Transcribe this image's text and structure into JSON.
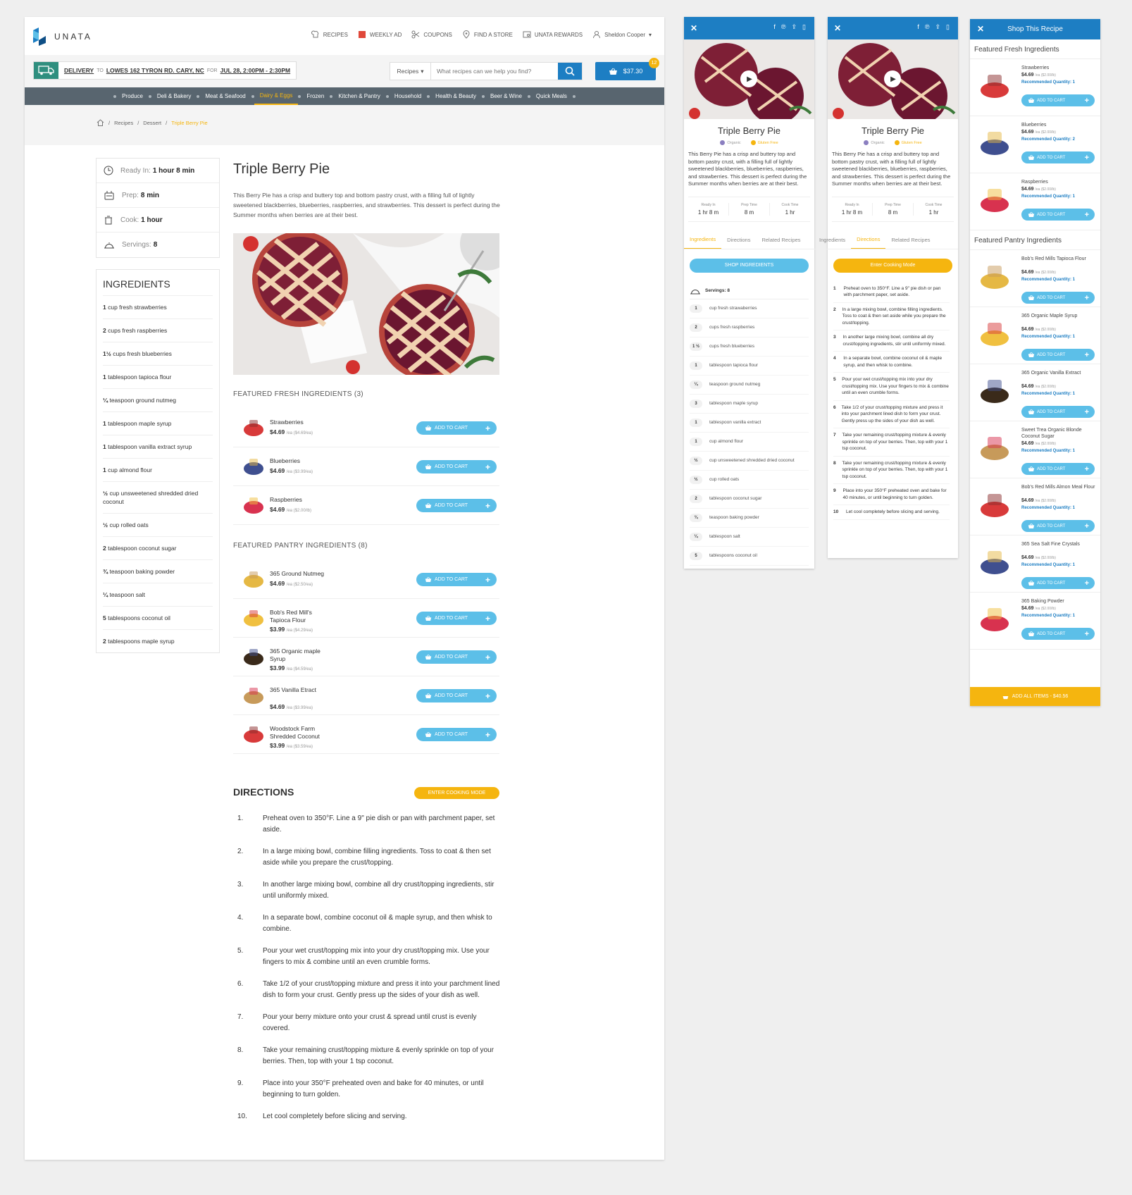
{
  "brand": {
    "name": "UNATA",
    "accent": "#1d7ec3",
    "secondary": "#5cbfe8",
    "highlight": "#f5b50f",
    "nav_bg": "#58656f"
  },
  "top_nav": [
    {
      "label": "Recipes",
      "icon": "chef-hat-icon"
    },
    {
      "label": "Weekly Ad",
      "icon": "flyer-icon"
    },
    {
      "label": "Coupons",
      "icon": "scissors-icon"
    },
    {
      "label": "Find a Store",
      "icon": "map-pin-icon"
    },
    {
      "label": "Unata Rewards",
      "icon": "rewards-card-icon"
    },
    {
      "label": "Sheldon Cooper",
      "icon": "user-icon"
    }
  ],
  "delivery": {
    "label": "DELIVERY",
    "to": "TO",
    "address": "LOWES 162 TYRON RD. CARY, NC",
    "for": "FOR",
    "time": "JUL 28, 2:00PM - 2:30PM"
  },
  "search": {
    "scope": "Recipes",
    "placeholder": "What recipes can we help you find?"
  },
  "cart": {
    "total": "$37.30",
    "count": "12"
  },
  "categories": [
    "Produce",
    "Deli & Bakery",
    "Meat & Seafood",
    "Dairy & Eggs",
    "Frozen",
    "Kitchen & Pantry",
    "Household",
    "Health & Beauty",
    "Beer & Wine",
    "Quick Meals"
  ],
  "active_category": "Dairy & Eggs",
  "breadcrumb": [
    "Recipes",
    "Dessert",
    "Triple Berry Pie"
  ],
  "recipe": {
    "title": "Triple Berry Pie",
    "description": "This Berry Pie has a crisp and buttery top and bottom pastry crust, with a filling full of lightly sweetened blackberries, blueberries, raspberries, and strawberries. This dessert is perfect during the Summer months when berries are at their best.",
    "ready_label": "Ready In:",
    "ready": "1 hour 8 min",
    "prep_label": "Prep:",
    "prep": "8 min",
    "cook_label": "Cook:",
    "cook": "1 hour",
    "servings_label": "Servings:",
    "servings": "8",
    "tags": [
      "Organic",
      "Gluten Free"
    ]
  },
  "ingredients_title": "INGREDIENTS",
  "ingredients": [
    {
      "qty": "1",
      "unit": "cup fresh strawberries"
    },
    {
      "qty": "2",
      "unit": "cups fresh raspberries"
    },
    {
      "qty": "1½",
      "unit": "cups fresh blueberries"
    },
    {
      "qty": "1",
      "unit": "tablespoon tapioca flour"
    },
    {
      "qty": "¼",
      "unit": "teaspoon ground nutmeg"
    },
    {
      "qty": "1",
      "unit": "tablespoon maple syrup"
    },
    {
      "qty": "1",
      "unit": "tablespoon vanilla extract syrup"
    },
    {
      "qty": "1",
      "unit": "cup almond flour"
    },
    {
      "qty": "½",
      "unit": "cup unsweetened shredded dried coconut"
    },
    {
      "qty": "½",
      "unit": "cup rolled oats"
    },
    {
      "qty": "2",
      "unit": "tablespoon coconut sugar"
    },
    {
      "qty": "¾",
      "unit": "teaspoon baking powder"
    },
    {
      "qty": "¼",
      "unit": "teaspoon salt"
    },
    {
      "qty": "5",
      "unit": "tablespoons coconut oil"
    },
    {
      "qty": "2",
      "unit": "tablespoons maple syrup"
    }
  ],
  "fresh_title": "FEATURED FRESH INGREDIENTS (3)",
  "fresh": [
    {
      "name": "Strawberries",
      "price": "$4.69",
      "unit": "/ea ($4.69/ea)"
    },
    {
      "name": "Blueberries",
      "price": "$4.69",
      "unit": "/ea ($3.99/ea)"
    },
    {
      "name": "Raspberries",
      "price": "$4.69",
      "unit": "/ea ($2.00/lb)"
    }
  ],
  "pantry_title": "FEATURED PANTRY INGREDIENTS (8)",
  "pantry": [
    {
      "name": "365 Ground Nutmeg",
      "price": "$4.69",
      "unit": "/ea ($2.50/ea)"
    },
    {
      "name": "Bob's Red Mill's Tapioca Flour",
      "price": "$3.99",
      "unit": "/ea ($4.29/ea)"
    },
    {
      "name": "365 Organic maple Syrup",
      "price": "$3.99",
      "unit": "/ea ($4.59/ea)"
    },
    {
      "name": "365 Vanilla Etract",
      "price": "$4.69",
      "unit": "/ea ($3.99/ea)"
    },
    {
      "name": "Woodstock Farm Shredded Coconut",
      "price": "$3.99",
      "unit": "/ea ($3.59/ea)"
    }
  ],
  "add_to_cart": "ADD TO CART",
  "directions_title": "DIRECTIONS",
  "cooking_mode": "ENTER COOKING MODE",
  "directions": [
    "Preheat oven to 350°F. Line a 9\" pie dish or pan with parchment paper, set aside.",
    "In a large mixing bowl, combine filling ingredients. Toss to coat & then set aside while you prepare the crust/topping.",
    "In another large mixing bowl, combine all dry crust/topping ingredients, stir until uniformly mixed.",
    "In a separate bowl, combine coconut oil & maple syrup, and then whisk to combine.",
    "Pour your wet crust/topping mix into your dry crust/topping mix. Use your fingers to mix & combine until an even crumble forms.",
    "Take 1/2 of your crust/topping mixture and press it into your parchment lined dish to form your crust. Gently press up the sides of your dish as well.",
    "Pour your berry mixture onto your crust & spread until crust is evenly covered.",
    "Take your remaining crust/topping mixture & evenly sprinkle on top of your berries. Then, top with your 1 tsp coconut.",
    "Place into your 350°F preheated oven and bake for 40 minutes, or until beginning to turn golden.",
    "Let cool completely before slicing and serving."
  ],
  "mobile": {
    "ready_label": "Ready In",
    "ready": "1 hr 8 m",
    "prep_label": "Prep Time",
    "prep": "8 m",
    "cook_label": "Cook Time",
    "cook": "1 hr",
    "tabs": [
      "Ingredients",
      "Directions",
      "Related Recipes"
    ],
    "shop_ingredients": "SHOP INGREDIENTS",
    "cooking_mode": "Enter Cooking Mode",
    "servings": "Servings: 8",
    "ingredients": [
      {
        "q": "1",
        "t": "cup fresh strawaberries"
      },
      {
        "q": "2",
        "t": "cups fresh raspberries"
      },
      {
        "q": "1 ½",
        "t": "cups fresh blueberries"
      },
      {
        "q": "1",
        "t": "tablespoon tapioca flour"
      },
      {
        "q": "¼",
        "t": "teaspoon ground nutmeg"
      },
      {
        "q": "3",
        "t": "tablespoon maple syrup"
      },
      {
        "q": "1",
        "t": "tablespoon vanilla extract"
      },
      {
        "q": "1",
        "t": "cup almond flour"
      },
      {
        "q": "½",
        "t": "cup unsweetened shredded dried coconut"
      },
      {
        "q": "½",
        "t": "cup rolled oats"
      },
      {
        "q": "2",
        "t": "tablespoon coconut sugar"
      },
      {
        "q": "¾",
        "t": "teaspoon baking powder"
      },
      {
        "q": "¼",
        "t": "tablespoon salt"
      },
      {
        "q": "5",
        "t": "tablespoons coconut oil"
      }
    ],
    "directions": [
      "Preheat oven to 350°F. Line a 9\" pie dish or pan with parchment paper, set aside.",
      "In a large mixing bowl, combine filling ingredients. Toss to coat & then set aside while you prepare the crust/topping.",
      "In another large mixing bowl, combine all dry crust/topping ingredients, stir until uniformly mixed.",
      "In a separate bowl, combine coconut oil & maple syrup, and then whisk to combine.",
      "Pour your wet crust/topping mix into your dry crust/topping mix. Use your fingers to mix & combine until an even crumble forms.",
      "Take 1/2 of your crust/topping mixture and press it into your parchment lined dish to form your crust. Gently press up the sides of your dish as well.",
      "Take your remaining crust/topping mixture & evenly sprinkle on top of your berries. Then, top with your 1 tsp coconut.",
      "Take your remaining crust/topping mixture & evenly sprinkle on top of your berries. Then, top with your 1 tsp coconut.",
      "Place into your 350°F preheated oven and bake for 40 minutes, or until beginning to turn golden.",
      "Let cool completely before slicing and serving."
    ]
  },
  "shop_panel": {
    "title": "Shop This Recipe",
    "fresh_title": "Featured Fresh Ingredients",
    "pantry_title": "Featured Pantry Ingredients",
    "rec_label": "Recommended Quantity:",
    "fresh": [
      {
        "name": "Strawberries",
        "price": "$4.69",
        "unit": "/ea ($2.00/lb)",
        "rq": "Recommended Quantity: 1"
      },
      {
        "name": "Blueberries",
        "price": "$4.69",
        "unit": "/ea ($2.00/lb)",
        "rq": "Recommended Quantity: 2"
      },
      {
        "name": "Raspberries",
        "price": "$4.69",
        "unit": "/ea ($2.00/lb)",
        "rq": "Recommended Quantity: 1"
      }
    ],
    "pantry": [
      {
        "name": "Bob's Red Mills Tapioca Flour",
        "price": "$4.69",
        "unit": "/ea ($2.00/lb)",
        "rq": "Recommended Quantity: 1"
      },
      {
        "name": "365 Organic Maple Syrup",
        "price": "$4.69",
        "unit": "/ea ($2.00/lb)",
        "rq": "Recommended Quantity: 1"
      },
      {
        "name": "365 Organic Vanilla Extract",
        "price": "$4.69",
        "unit": "/ea ($2.00/lb)",
        "rq": "Recommended Quantity: 1"
      },
      {
        "name": "Sweet Trea Organic Blonde Coconut Sugar",
        "price": "$4.69",
        "unit": "/ea ($2.00/lb)",
        "rq": "Recommended Quantity: 1"
      },
      {
        "name": "Bob's Red Mills Almon Meal Flour",
        "price": "$4.69",
        "unit": "/ea ($2.00/lb)",
        "rq": "Recommended Quantity: 1"
      },
      {
        "name": "365 Sea Salt Fine Crystals",
        "price": "$4.69",
        "unit": "/ea ($2.00/lb)",
        "rq": "Recommended Quantity: 1"
      },
      {
        "name": "365 Baking Powder",
        "price": "$4.69",
        "unit": "/ea ($2.00/lb)",
        "rq": "Recommended Quantity: 1"
      }
    ],
    "add_all": "ADD ALL ITEMS - $40.56"
  }
}
